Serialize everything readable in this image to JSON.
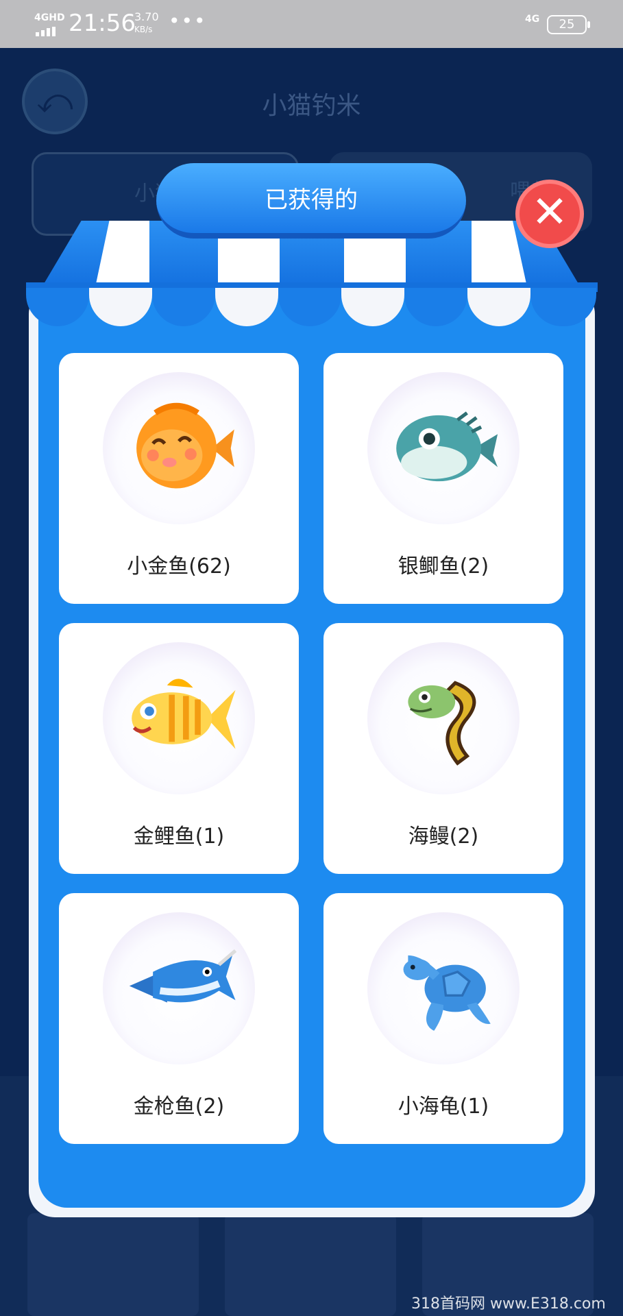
{
  "status_bar": {
    "network": "4GHD",
    "time": "21:56",
    "speed_value": "3.70",
    "speed_unit": "KB/s",
    "more": "•••",
    "network_right": "4G",
    "battery": "25"
  },
  "background": {
    "title": "小猫钓米",
    "tab_left": "小猫钓",
    "tab_right": "喂养"
  },
  "modal": {
    "title": "已获得的",
    "close_icon": "close-icon",
    "colors": {
      "primary": "#1d8bf0",
      "close": "#f14b4b"
    }
  },
  "items": [
    {
      "label": "小金鱼(62)",
      "icon": "goldfish-icon"
    },
    {
      "label": "银鲫鱼(2)",
      "icon": "pufferfish-icon"
    },
    {
      "label": "金鲤鱼(1)",
      "icon": "carp-icon"
    },
    {
      "label": "海鳗(2)",
      "icon": "eel-icon"
    },
    {
      "label": "金枪鱼(2)",
      "icon": "swordfish-icon"
    },
    {
      "label": "小海龟(1)",
      "icon": "turtle-icon"
    }
  ],
  "watermark": "318首码网 www.E318.com"
}
